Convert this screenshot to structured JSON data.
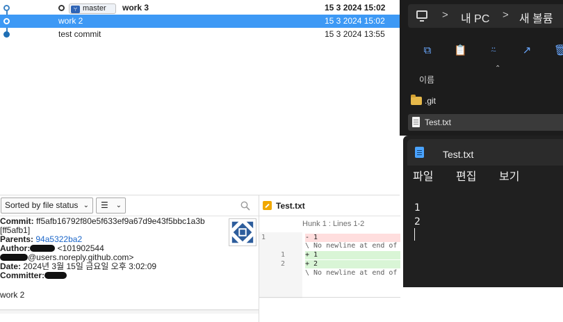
{
  "commits": [
    {
      "message": "work 3",
      "date": "15 3 2024 15:02",
      "branch": "master",
      "is_head": true
    },
    {
      "message": "work 2",
      "date": "15 3 2024 15:02",
      "selected": true
    },
    {
      "message": "test commit",
      "date": "15 3 2024 13:55"
    }
  ],
  "details_toolbar": {
    "sort_label": "Sorted by file status",
    "view_icon": "list-icon"
  },
  "commit_info": {
    "commit_label": "Commit:",
    "commit_hash": "ff5afb16792f80e5f633ef9a67d9e43f5bbc1a3b",
    "short_hash": "[ff5afb1]",
    "parents_label": "Parents:",
    "parent_hash": "94a5322ba2",
    "author_label": "Author:",
    "author_email_start": "<101902544",
    "author_email_end": "@users.noreply.github.com>",
    "date_label": "Date:",
    "date_value": "2024년 3월 15일 금요일 오후 3:02:09",
    "committer_label": "Committer:",
    "message": "work 2"
  },
  "diff": {
    "file_name": "Test.txt",
    "hunk_header": "Hunk 1 : Lines 1-2",
    "lines": [
      {
        "old": "1",
        "new": "",
        "text": "- 1",
        "kind": "del"
      },
      {
        "old": "",
        "new": "",
        "text": "\\ No newline at end of file",
        "kind": "note"
      },
      {
        "old": "",
        "new": "1",
        "text": "+ 1",
        "kind": "add"
      },
      {
        "old": "",
        "new": "2",
        "text": "+ 2",
        "kind": "add"
      },
      {
        "old": "",
        "new": "",
        "text": "\\ No newline at end of file",
        "kind": "note"
      }
    ]
  },
  "explorer": {
    "crumbs": [
      "내 PC",
      "새 볼륨"
    ],
    "column_name": "이름",
    "items": [
      {
        "name": ".git",
        "type": "folder"
      },
      {
        "name": "Test.txt",
        "type": "file",
        "selected": true
      }
    ],
    "command_icons": [
      "copy-icon",
      "paste-icon",
      "rename-icon",
      "share-icon",
      "delete-icon"
    ]
  },
  "notepad": {
    "tab_title": "Test.txt",
    "menu": [
      "파일",
      "편집",
      "보기"
    ],
    "lines": [
      "1",
      "2"
    ]
  },
  "colors": {
    "selection_blue": "#3d99f5",
    "graph_line": "#3a82c4",
    "link_blue": "#1b66c9",
    "diff_added": "#d9f5d6",
    "diff_removed": "#ffdede",
    "explorer_bg": "#1c1c1c",
    "notepad_bg": "#202020"
  }
}
